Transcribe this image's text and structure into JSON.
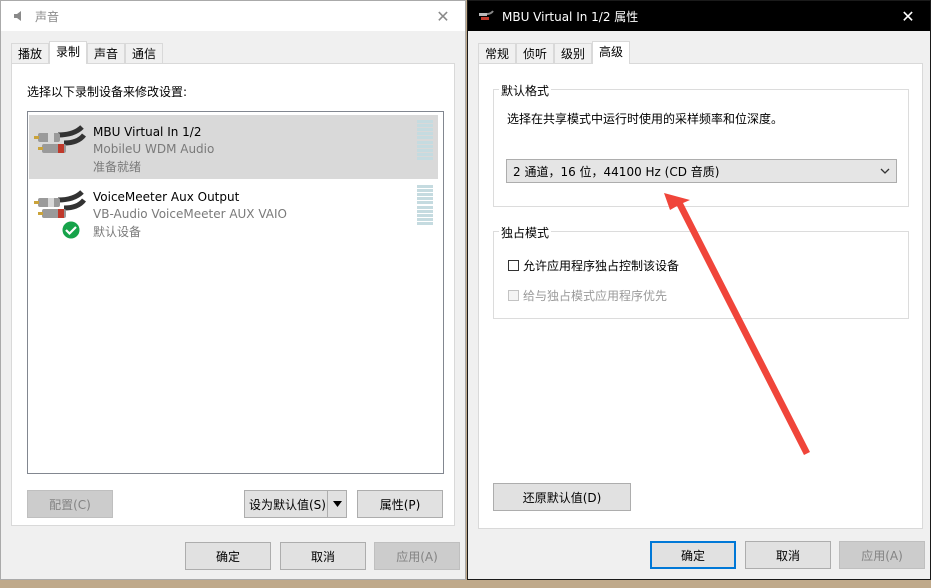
{
  "sound_window": {
    "title": "声音",
    "tabs": [
      "播放",
      "录制",
      "声音",
      "通信"
    ],
    "active_tab": 1,
    "instruction": "选择以下录制设备来修改设置:",
    "devices": [
      {
        "name": "MBU Virtual In 1/2",
        "driver": "MobileU WDM Audio",
        "status": "准备就绪",
        "selected": true,
        "default": false
      },
      {
        "name": "VoiceMeeter Aux Output",
        "driver": "VB-Audio VoiceMeeter AUX VAIO",
        "status": "默认设备",
        "selected": false,
        "default": true
      }
    ],
    "buttons": {
      "configure": "配置(C)",
      "set_default": "设为默认值(S)",
      "properties": "属性(P)",
      "ok": "确定",
      "cancel": "取消",
      "apply": "应用(A)"
    }
  },
  "props_window": {
    "title": "MBU Virtual In 1/2 属性",
    "tabs": [
      "常规",
      "侦听",
      "级别",
      "高级"
    ],
    "active_tab": 3,
    "default_format": {
      "label": "默认格式",
      "description": "选择在共享模式中运行时使用的采样频率和位深度。",
      "selected_format": "2 通道，16 位，44100 Hz (CD 音质)"
    },
    "exclusive_mode": {
      "label": "独占模式",
      "allow_exclusive": "允许应用程序独占控制该设备",
      "exclusive_priority": "给与独占模式应用程序优先"
    },
    "buttons": {
      "restore_defaults": "还原默认值(D)",
      "ok": "确定",
      "cancel": "取消",
      "apply": "应用(A)"
    }
  },
  "colors": {
    "annotation_arrow": "#f0453a",
    "focus_border": "#0078d7",
    "selection": "#d9d9d9",
    "check_green": "#16a34a"
  }
}
